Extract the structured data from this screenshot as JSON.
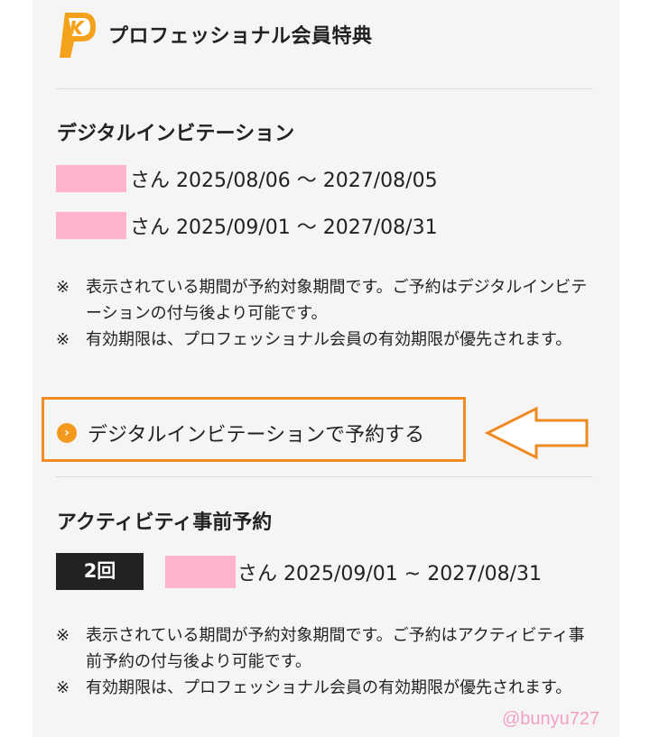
{
  "header": {
    "title": "プロフェッショナル会員特典",
    "logo_letter": "K"
  },
  "digital_invitation": {
    "title": "デジタルインビテーション",
    "periods": [
      {
        "suffix": "さん 2025/08/06 〜 2027/08/05"
      },
      {
        "suffix": "さん 2025/09/01 〜 2027/08/31"
      }
    ],
    "notes": [
      {
        "mark": "※",
        "text": "表示されている期間が予約対象期間です。ご予約はデジタルインビテーションの付与後より可能です。"
      },
      {
        "mark": "※",
        "text": "有効期限は、プロフェッショナル会員の有効期限が優先されます。"
      }
    ],
    "link_label": "デジタルインビテーションで予約する",
    "link_icon": "›"
  },
  "activity": {
    "title": "アクティビティ事前予約",
    "badge": "2回",
    "period_suffix": "さん 2025/09/01 ~ 2027/08/31",
    "notes": [
      {
        "mark": "※",
        "text": "表示されている期間が予約対象期間です。ご予約はアクティビティ事前予約の付与後より可能です。"
      },
      {
        "mark": "※",
        "text": "有効期限は、プロフェッショナル会員の有効期限が優先されます。"
      }
    ]
  },
  "watermark": "@bunyu727",
  "colors": {
    "accent_orange": "#f08a25",
    "redaction_pink": "#ffb3cf",
    "badge_dark": "#222222"
  }
}
